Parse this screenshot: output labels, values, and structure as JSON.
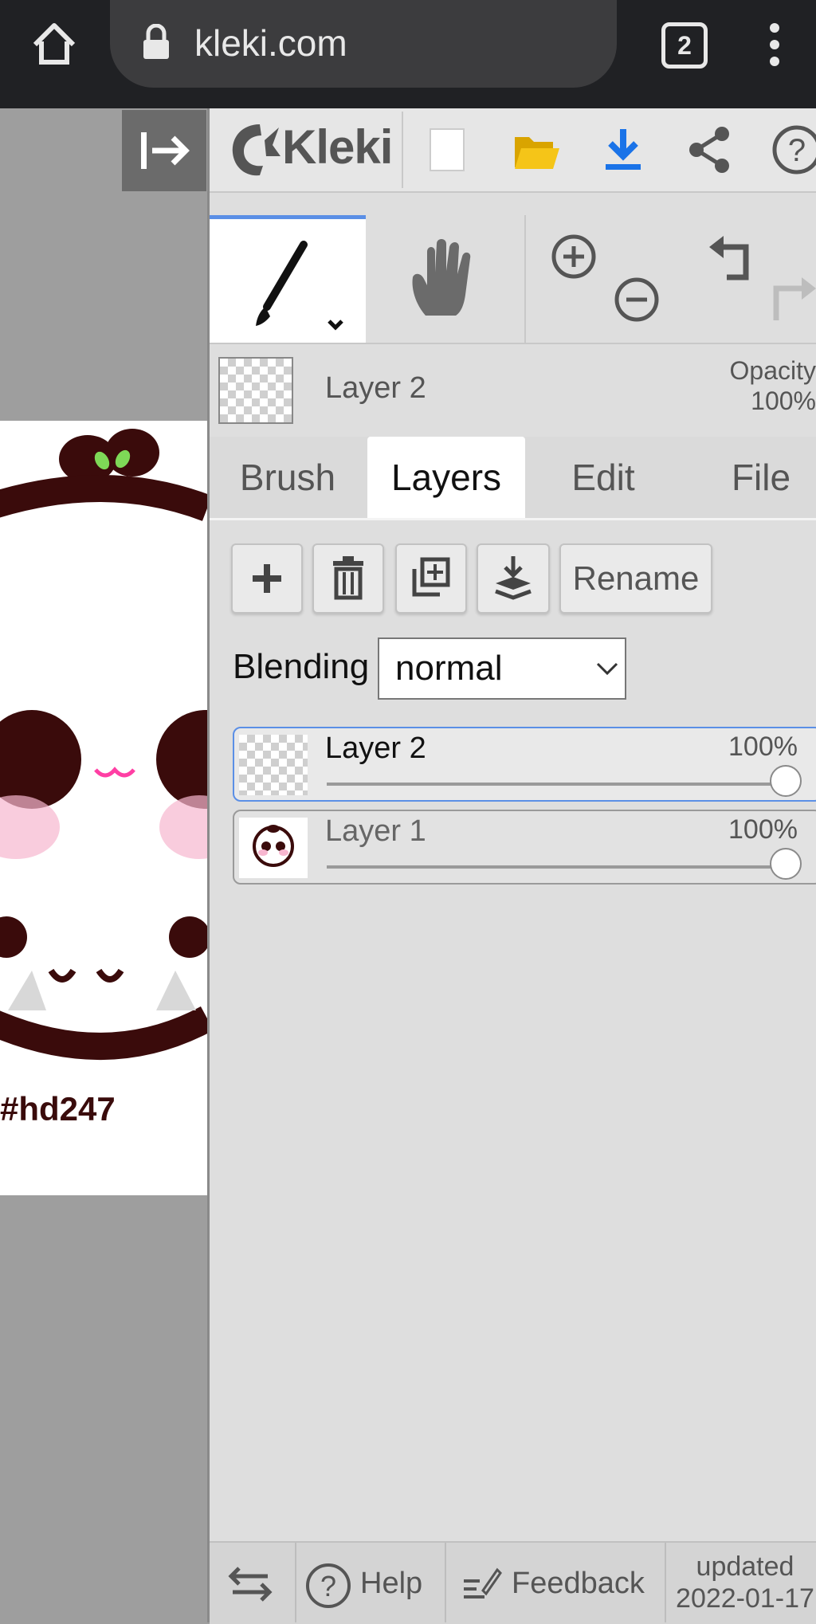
{
  "browser": {
    "url": "kleki.com",
    "tab_count": "2"
  },
  "app": {
    "logo": "Kleki",
    "current_layer": {
      "name": "Layer 2",
      "opacity_label": "Opacity",
      "opacity_value": "100%"
    },
    "tabs": [
      {
        "label": "Brush",
        "active": false
      },
      {
        "label": "Layers",
        "active": true
      },
      {
        "label": "Edit",
        "active": false
      },
      {
        "label": "File",
        "active": false
      }
    ],
    "layer_actions": {
      "rename_label": "Rename"
    },
    "blending": {
      "label": "Blending",
      "value": "normal"
    },
    "layers": [
      {
        "name": "Layer 2",
        "opacity": "100%",
        "opacity_fraction": 1.0,
        "selected": true
      },
      {
        "name": "Layer 1",
        "opacity": "100%",
        "opacity_fraction": 1.0,
        "selected": false
      }
    ],
    "footer": {
      "help_label": "Help",
      "feedback_label": "Feedback",
      "updated_label": "updated",
      "updated_date": "2022-01-17"
    }
  },
  "canvas": {
    "caption": "#hd247"
  },
  "colors": {
    "accent": "#5b8fe6",
    "download_blue": "#1a73e8",
    "folder_yellow": "#f5c518",
    "art_dark": "#3a0b0b"
  }
}
